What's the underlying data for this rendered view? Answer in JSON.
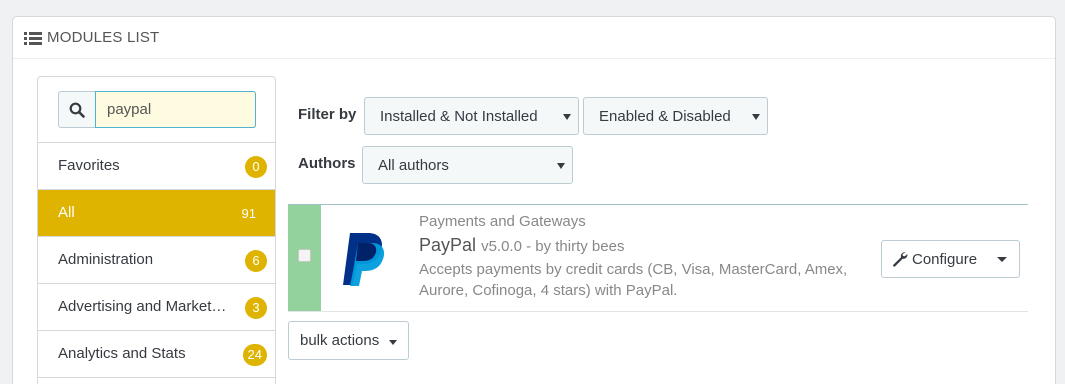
{
  "panel": {
    "title": "MODULES LIST",
    "icon": "list-icon"
  },
  "search": {
    "value": "paypal",
    "icon": "search-icon"
  },
  "categories": [
    {
      "label": "Favorites",
      "count": "0",
      "active": false
    },
    {
      "label": "All",
      "count": "91",
      "active": true
    },
    {
      "label": "Administration",
      "count": "6",
      "active": false
    },
    {
      "label": "Advertising and Market…",
      "count": "3",
      "active": false
    },
    {
      "label": "Analytics and Stats",
      "count": "24",
      "active": false
    }
  ],
  "filters": {
    "filter_by_label": "Filter by",
    "install_select": "Installed & Not Installed",
    "enable_select": "Enabled & Disabled",
    "authors_label": "Authors",
    "authors_select": "All authors"
  },
  "module": {
    "category": "Payments and Gateways",
    "name": "PayPal",
    "meta": "v5.0.0 - by thirty bees",
    "description": "Accepts payments by credit cards (CB, Visa, MasterCard, Amex, Aurore, Cofinoga, 4 stars) with PayPal.",
    "configure_label": "Configure",
    "status_color": "#93d29c"
  },
  "bulk": {
    "label": "bulk actions"
  },
  "colors": {
    "accent": "#dfb400",
    "search_border": "#4fb2d0"
  }
}
